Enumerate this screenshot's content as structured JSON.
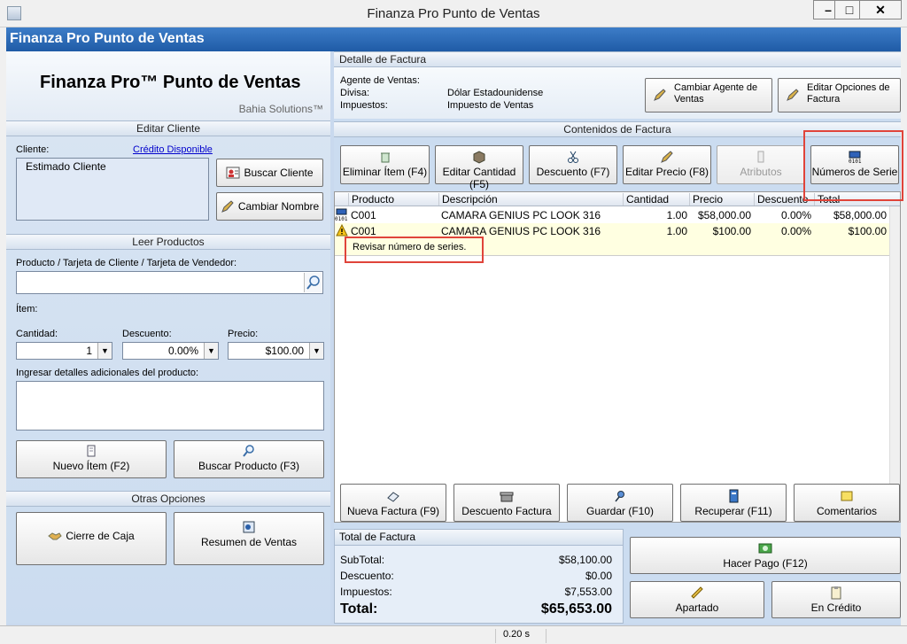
{
  "window": {
    "title": "Finanza Pro Punto de Ventas",
    "minimize": "–",
    "maximize": "□",
    "close": "✕"
  },
  "appbar": {
    "title": "Finanza Pro Punto de Ventas"
  },
  "brand": {
    "name": "Finanza Pro™ Punto de Ventas",
    "company": "Bahia Solutions™"
  },
  "editar_cliente": {
    "header": "Editar Cliente",
    "cliente_label": "Cliente:",
    "credito_link": "Crédito Disponible",
    "cliente_value": "Estimado Cliente",
    "buscar_cliente": "Buscar Cliente",
    "cambiar_nombre": "Cambiar Nombre"
  },
  "leer_productos": {
    "header": "Leer Productos",
    "producto_label": "Producto / Tarjeta de Cliente / Tarjeta de Vendedor:",
    "producto_value": "",
    "item_label": "Ítem:",
    "cantidad_label": "Cantidad:",
    "cantidad_value": "1",
    "descuento_label": "Descuento:",
    "descuento_value": "0.00%",
    "precio_label": "Precio:",
    "precio_value": "$100.00",
    "detalles_label": "Ingresar detalles adicionales del producto:",
    "detalles_value": "",
    "nuevo_item": "Nuevo Ítem (F2)",
    "buscar_producto": "Buscar Producto (F3)"
  },
  "otras_opciones": {
    "header": "Otras Opciones",
    "cierre_caja": "Cierre de Caja",
    "resumen_ventas": "Resumen de Ventas"
  },
  "detalle_factura": {
    "header": "Detalle de Factura",
    "agente_label": "Agente de Ventas:",
    "agente_value": "",
    "divisa_label": "Divisa:",
    "divisa_value": "Dólar Estadounidense",
    "impuestos_label": "Impuestos:",
    "impuestos_value": "Impuesto de Ventas",
    "cambiar_agente": "Cambiar Agente de Ventas",
    "editar_opciones": "Editar Opciones de Factura"
  },
  "contenidos": {
    "header": "Contenidos de Factura",
    "toolbar": {
      "eliminar": "Eliminar Ítem (F4)",
      "editar_cantidad": "Editar Cantidad (F5)",
      "descuento": "Descuento (F7)",
      "editar_precio": "Editar Precio (F8)",
      "atributos": "Atributos",
      "numeros_serie": "Números de Serie"
    },
    "columns": [
      "Producto",
      "Descripción",
      "Cantidad",
      "Precio",
      "Descuento",
      "Total"
    ],
    "rows": [
      {
        "producto": "C001",
        "descripcion": "CAMARA GENIUS PC LOOK 316",
        "cantidad": "1.00",
        "precio": "$58,000.00",
        "descuento": "0.00%",
        "total": "$58,000.00",
        "icon": "serial-number-icon"
      },
      {
        "producto": "C001",
        "descripcion": "CAMARA GENIUS PC LOOK 316",
        "cantidad": "1.00",
        "precio": "$100.00",
        "descuento": "0.00%",
        "total": "$100.00",
        "icon": "warning-icon"
      }
    ],
    "warning_message": "Revisar número de series."
  },
  "acciones": {
    "nueva_factura": "Nueva Factura (F9)",
    "descuento_factura": "Descuento Factura",
    "guardar": "Guardar (F10)",
    "recuperar": "Recuperar (F11)",
    "comentarios": "Comentarios"
  },
  "total_factura": {
    "header": "Total de Factura",
    "subtotal_label": "SubTotal:",
    "subtotal_value": "$58,100.00",
    "descuento_label": "Descuento:",
    "descuento_value": "$0.00",
    "impuestos_label": "Impuestos:",
    "impuestos_value": "$7,553.00",
    "total_label": "Total:",
    "total_value": "$65,653.00"
  },
  "pago": {
    "hacer_pago": "Hacer Pago (F12)",
    "apartado": "Apartado",
    "en_credito": "En Crédito"
  },
  "status": {
    "timer": "0.20 s"
  },
  "colors": {
    "accent_blue": "#1f5ba6",
    "highlight_red": "#e0443a",
    "warning_yellow": "#ffffe1"
  }
}
